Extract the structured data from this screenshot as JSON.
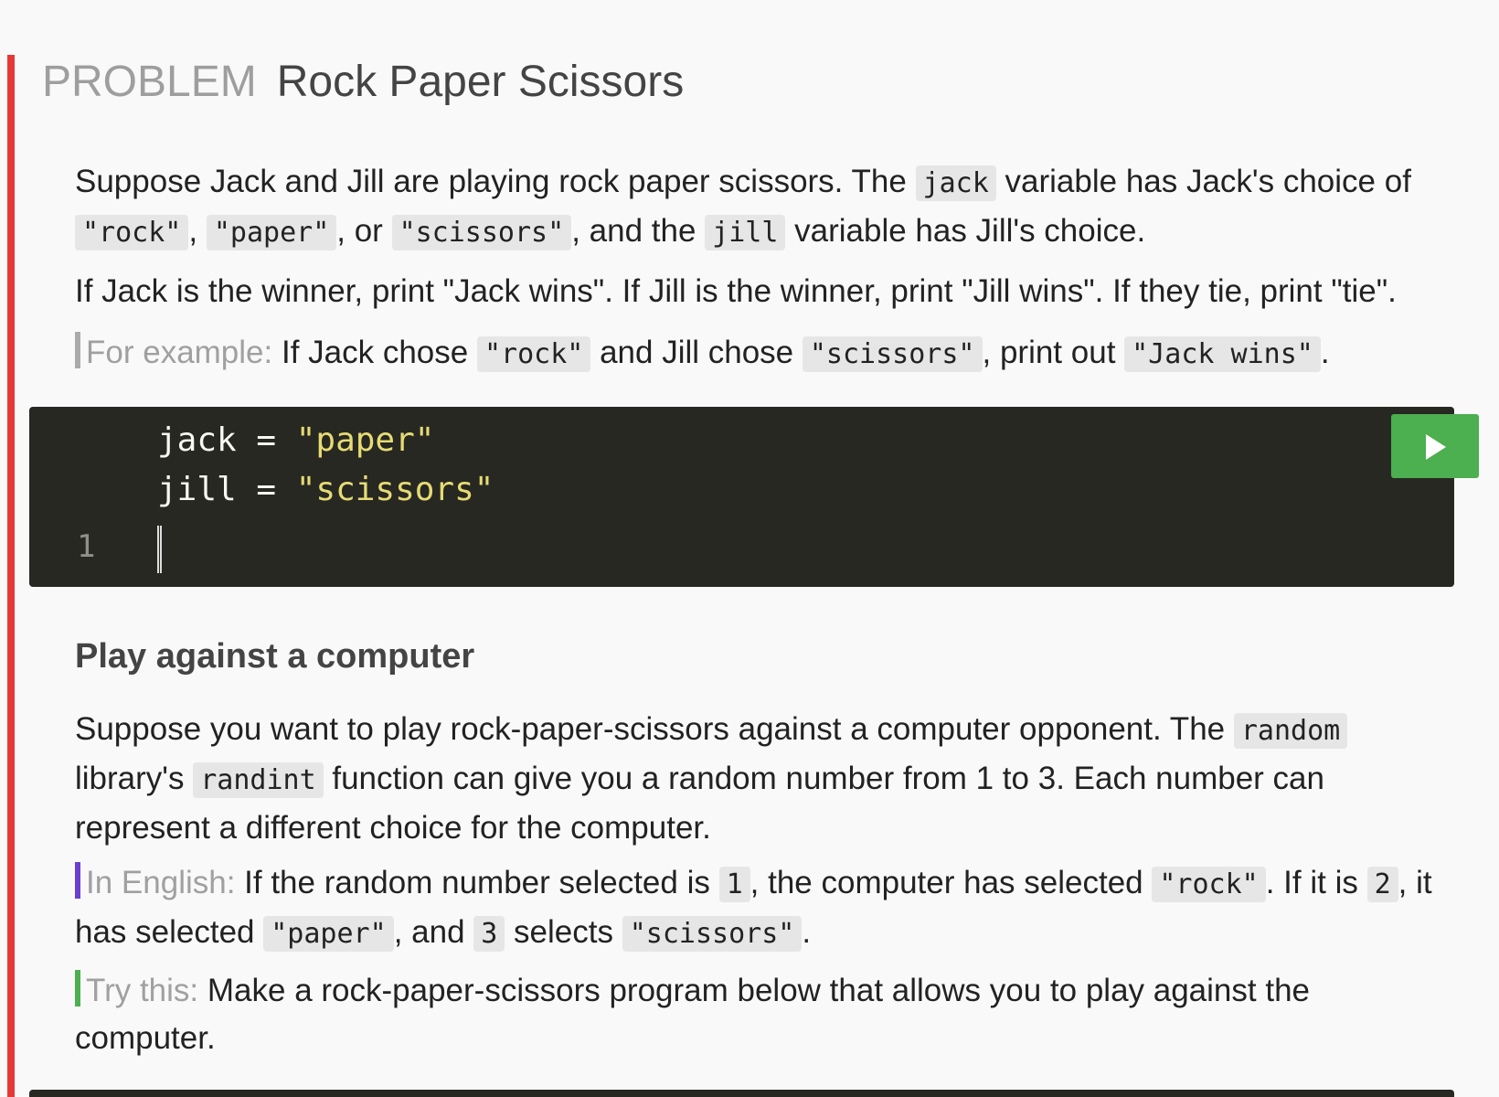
{
  "problem": {
    "kicker": "PROBLEM",
    "title": "Rock Paper Scissors"
  },
  "p1": {
    "t1": "Suppose Jack and Jill are playing rock paper scissors. The ",
    "c1": "jack",
    "t2": " variable has Jack's choice of ",
    "c2": "\"rock\"",
    "t3": ", ",
    "c3": "\"paper\"",
    "t4": ", or ",
    "c4": "\"scissors\"",
    "t5": ", and the ",
    "c5": "jill",
    "t6": " variable has Jill's choice."
  },
  "p2": {
    "text": "If Jack is the winner, print \"Jack wins\". If Jill is the winner, print \"Jill wins\". If they tie, print \"tie\"."
  },
  "p3": {
    "label": "For example:",
    "t1": " If Jack chose ",
    "c1": "\"rock\"",
    "t2": " and Jill chose ",
    "c2": "\"scissors\"",
    "t3": ", print out ",
    "c3": "\"Jack wins\"",
    "t4": "."
  },
  "editor": {
    "line1_var": "jack = ",
    "line1_str": "\"paper\"",
    "line2_var": "jill = ",
    "line2_str": "\"scissors\"",
    "line_number": "1",
    "run_icon": "play-icon"
  },
  "section": {
    "heading": "Play against a computer"
  },
  "p4": {
    "t1": "Suppose you want to play rock-paper-scissors against a computer opponent. The ",
    "c1": "random",
    "t2": " library's ",
    "c2": "randint",
    "t3": " function can give you a random number from 1 to 3. Each number can represent a different choice for the computer."
  },
  "p5": {
    "label": "In English:",
    "t1": " If the random number selected is ",
    "c1": "1",
    "t2": ", the computer has selected ",
    "c2": "\"rock\"",
    "t3": ". If it is ",
    "c3": "2",
    "t4": ", it has selected ",
    "c4": "\"paper\"",
    "t5": ", and ",
    "c5": "3",
    "t6": " selects ",
    "c6": "\"scissors\"",
    "t7": "."
  },
  "p6": {
    "label": "Try this:",
    "t1": " Make a rock-paper-scissors program below that allows you to play against the computer."
  },
  "colors": {
    "problem_bar": "#e53935",
    "run_button": "#4caf50",
    "editor_bg": "#272822",
    "string": "#e6db74",
    "english_bar": "#6c3fd0",
    "try_bar": "#4caf50"
  }
}
